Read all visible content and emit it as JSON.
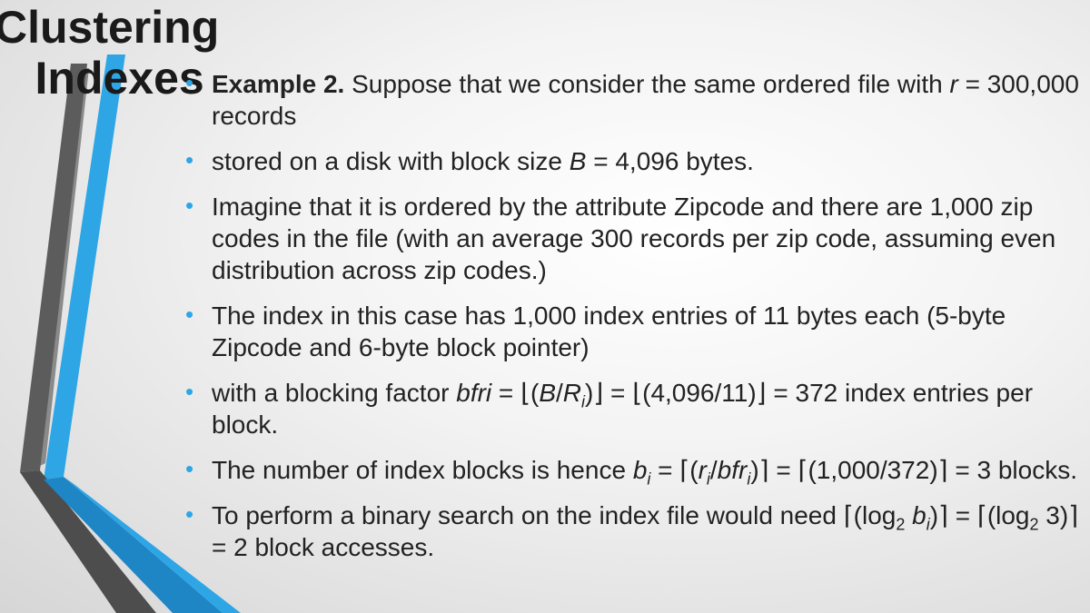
{
  "slide": {
    "title_line1": "Clustering",
    "title_line2": "Indexes"
  },
  "bullets": [
    {
      "lead": "Example 2.",
      "text": " Suppose that we consider the same ordered file with ",
      "var": "r",
      "tail": " = 300,000 records"
    },
    {
      "text": "stored on a disk with block size ",
      "var": "B",
      "tail": " = 4,096 bytes."
    },
    {
      "text": "Imagine that it is ordered by the attribute Zipcode and there are 1,000 zip codes in the file (with an average 300 records per zip code, assuming even distribution across zip codes.)"
    },
    {
      "text": "The index in this case has 1,000 index entries of 11 bytes each (5-byte Zipcode and 6-byte block pointer)"
    },
    {
      "t1": "with a blocking factor ",
      "v_bfri": "bfri",
      "t2": " = ⌊(",
      "v_B": "B",
      "t3": "/",
      "v_R": "R",
      "sub_i": "i",
      "t4": ")⌋ = ⌊(4,096/11)⌋  = 372 index entries per block."
    },
    {
      "t1": "The number of index blocks is hence ",
      "v_b": "b",
      "sub_i": "i",
      "t2": " = ⌈(",
      "v_r": "r",
      "sub_i2": "i",
      "t3": "/",
      "v_bfr": "bfr",
      "sub_i3": "i",
      "t4": ")⌉ = ⌈(1,000/372)⌉ = 3 blocks."
    },
    {
      "t1": "To perform a binary search on the index file would need ⌈(log",
      "sub_2": "2",
      "t2": " ",
      "v_b": "b",
      "sub_i": "i",
      "t3": ")⌉ = ⌈(log",
      "sub_2b": "2",
      "t4": " 3)⌉ = 2 block accesses."
    }
  ],
  "colors": {
    "bullet": "#2ea6e6",
    "accent_dark": "#555555",
    "accent_blue": "#2ea6e6"
  }
}
